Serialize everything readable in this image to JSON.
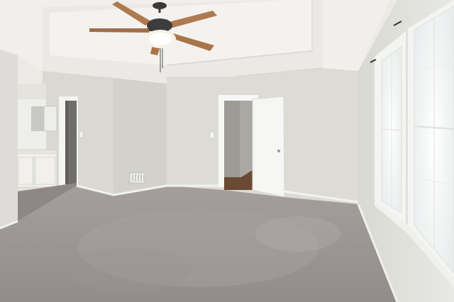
{
  "photo": {
    "subject": "",
    "objects": [
      {
        "id": "ceiling-fan",
        "icon": "ceiling-fan-icon"
      },
      {
        "id": "tray-ceiling"
      },
      {
        "id": "open-door"
      },
      {
        "id": "bathroom-vanity"
      },
      {
        "id": "windows"
      },
      {
        "id": "carpet"
      },
      {
        "id": "floor-vent"
      },
      {
        "id": "baseboards"
      }
    ]
  },
  "colors": {
    "wall": "#dddcd7",
    "wall_shadow": "#cfcfca",
    "ceiling": "#eeede9",
    "carpet": "#9d9696",
    "carpet_light": "#b2acaa",
    "trim": "#f7f7f5",
    "fan_blade": "#b07a4f",
    "hall_floor": "#6b4a34",
    "window_glass": "#f5f7f7"
  }
}
